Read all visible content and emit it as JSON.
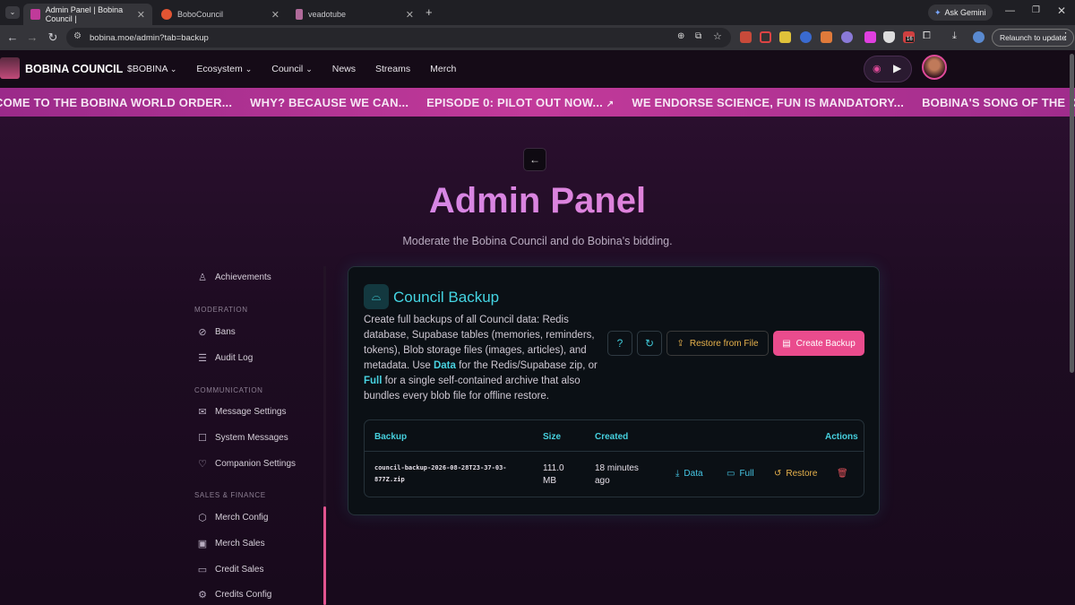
{
  "browser": {
    "tabs": [
      {
        "title": "Admin Panel | Bobina Council |",
        "favcolor": "#c03a9a"
      },
      {
        "title": "BoboCouncil",
        "favcolor": "#e25533"
      },
      {
        "title": "veadotube",
        "favcolor": "#b06a9a"
      }
    ],
    "new_tab": "+",
    "url": "bobina.moe/admin?tab=backup",
    "ask_gemini": "Ask Gemini",
    "relaunch": "Relaunch to update",
    "ext_badge": "16"
  },
  "site": {
    "brand": "BOBINA COUNCIL",
    "nav": [
      "$BOBINA",
      "Ecosystem",
      "Council",
      "News",
      "Streams",
      "Merch"
    ],
    "ticker": [
      "COME TO THE BOBINA WORLD ORDER...",
      "WHY? BECAUSE WE CAN...",
      "EPISODE 0: PILOT OUT NOW...",
      "WE ENDORSE SCIENCE, FUN IS MANDATORY...",
      "BOBINA'S SONG OF THE DAY IS DIFFERENT"
    ]
  },
  "page": {
    "title": "Admin Panel",
    "subtitle": "Moderate the Bobina Council and do Bobina's bidding."
  },
  "sidebar": {
    "items": [
      {
        "label": "Achievements",
        "icon": "award-icon",
        "glyph": "♙"
      },
      {
        "label": "Bans",
        "icon": "ban-icon",
        "glyph": "⊘"
      },
      {
        "label": "Audit Log",
        "icon": "log-icon",
        "glyph": "☰"
      },
      {
        "label": "Message Settings",
        "icon": "mail-icon",
        "glyph": "✉"
      },
      {
        "label": "System Messages",
        "icon": "chat-icon",
        "glyph": "☐"
      },
      {
        "label": "Companion Settings",
        "icon": "heart-icon",
        "glyph": "♡"
      },
      {
        "label": "Merch Config",
        "icon": "box-icon",
        "glyph": "⬡"
      },
      {
        "label": "Merch Sales",
        "icon": "cart-icon",
        "glyph": "▣"
      },
      {
        "label": "Credit Sales",
        "icon": "card-icon",
        "glyph": "▭"
      },
      {
        "label": "Credits Config",
        "icon": "gear-icon",
        "glyph": "⚙"
      }
    ],
    "sections": [
      "MODERATION",
      "COMMUNICATION",
      "SALES & FINANCE"
    ]
  },
  "backup": {
    "title": "Council Backup",
    "desc_1": "Create full backups of all Council data: Redis database, Supabase tables (memories, reminders, tokens), Blob storage files (images, articles), and metadata. Use ",
    "desc_data": "Data",
    "desc_2": " for the Redis/Supabase zip, or ",
    "desc_full": "Full",
    "desc_3": " for a single self-contained archive that also bundles every blob file for offline restore.",
    "restore_from_file": "Restore from File",
    "create_backup": "Create Backup",
    "table": {
      "headers": [
        "Backup",
        "Size",
        "Created",
        "Actions"
      ],
      "row": {
        "name_line1": "council-backup-2026-08-28T23-37-03-",
        "name_line2": "877Z.zip",
        "size_line1": "111.0",
        "size_line2": "MB",
        "created_line1": "18 minutes",
        "created_line2": "ago",
        "actions": [
          "Data",
          "Full",
          "Restore"
        ]
      }
    }
  },
  "colors": {
    "accent": "#44d4e2",
    "pink": "#ea4c8d",
    "amber": "#e7b24c"
  }
}
